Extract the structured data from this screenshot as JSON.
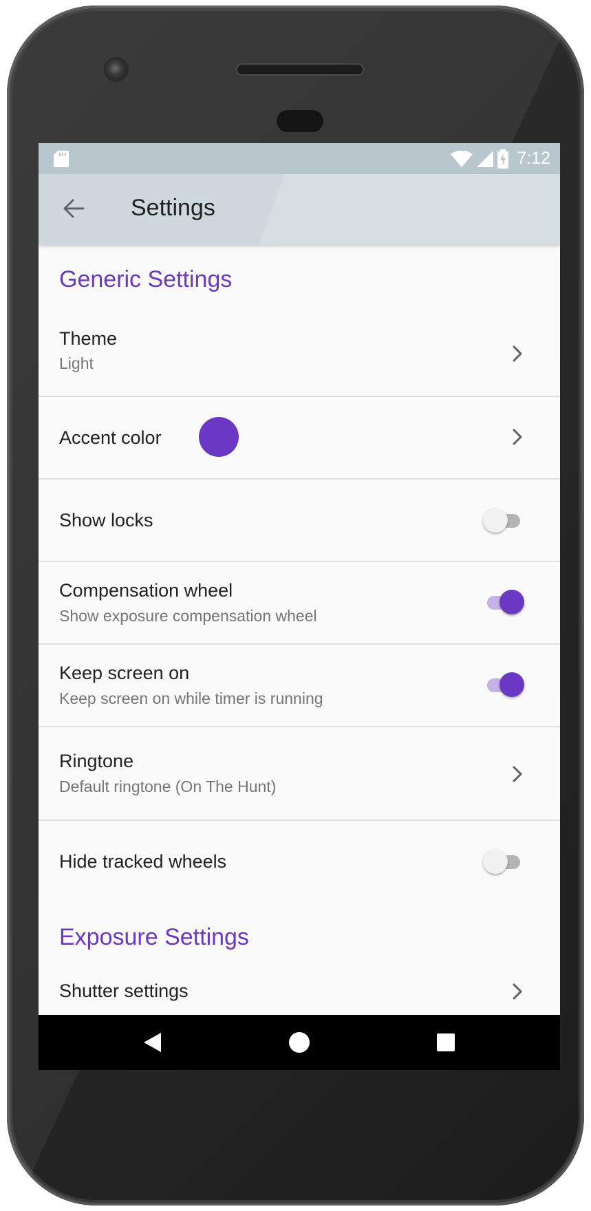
{
  "status_bar": {
    "time": "7:12",
    "icons": [
      "sd-card-icon",
      "wifi-icon",
      "cell-signal-icon",
      "battery-charging-icon"
    ]
  },
  "app_bar": {
    "title": "Settings",
    "back_icon": "arrow-left-icon"
  },
  "sections": {
    "generic": {
      "header": "Generic Settings",
      "theme": {
        "title": "Theme",
        "summary": "Light"
      },
      "accent_color": {
        "title": "Accent color",
        "color": "#6a38c2"
      },
      "show_locks": {
        "title": "Show locks",
        "enabled": false
      },
      "compensation_wheel": {
        "title": "Compensation wheel",
        "summary": "Show exposure compensation wheel",
        "enabled": true
      },
      "keep_screen_on": {
        "title": "Keep screen on",
        "summary": "Keep screen on while timer is running",
        "enabled": true
      },
      "ringtone": {
        "title": "Ringtone",
        "summary": "Default ringtone (On The Hunt)"
      },
      "hide_tracked_wheels": {
        "title": "Hide tracked wheels",
        "enabled": false
      }
    },
    "exposure": {
      "header": "Exposure Settings",
      "shutter_settings": {
        "title": "Shutter settings"
      }
    }
  },
  "nav_bar": {
    "icons": [
      "back-triangle-icon",
      "home-circle-icon",
      "recents-square-icon"
    ]
  },
  "colors": {
    "accent": "#6a38c2",
    "app_bar": "#cfd8dc",
    "status_bar": "#b8c6ce"
  }
}
